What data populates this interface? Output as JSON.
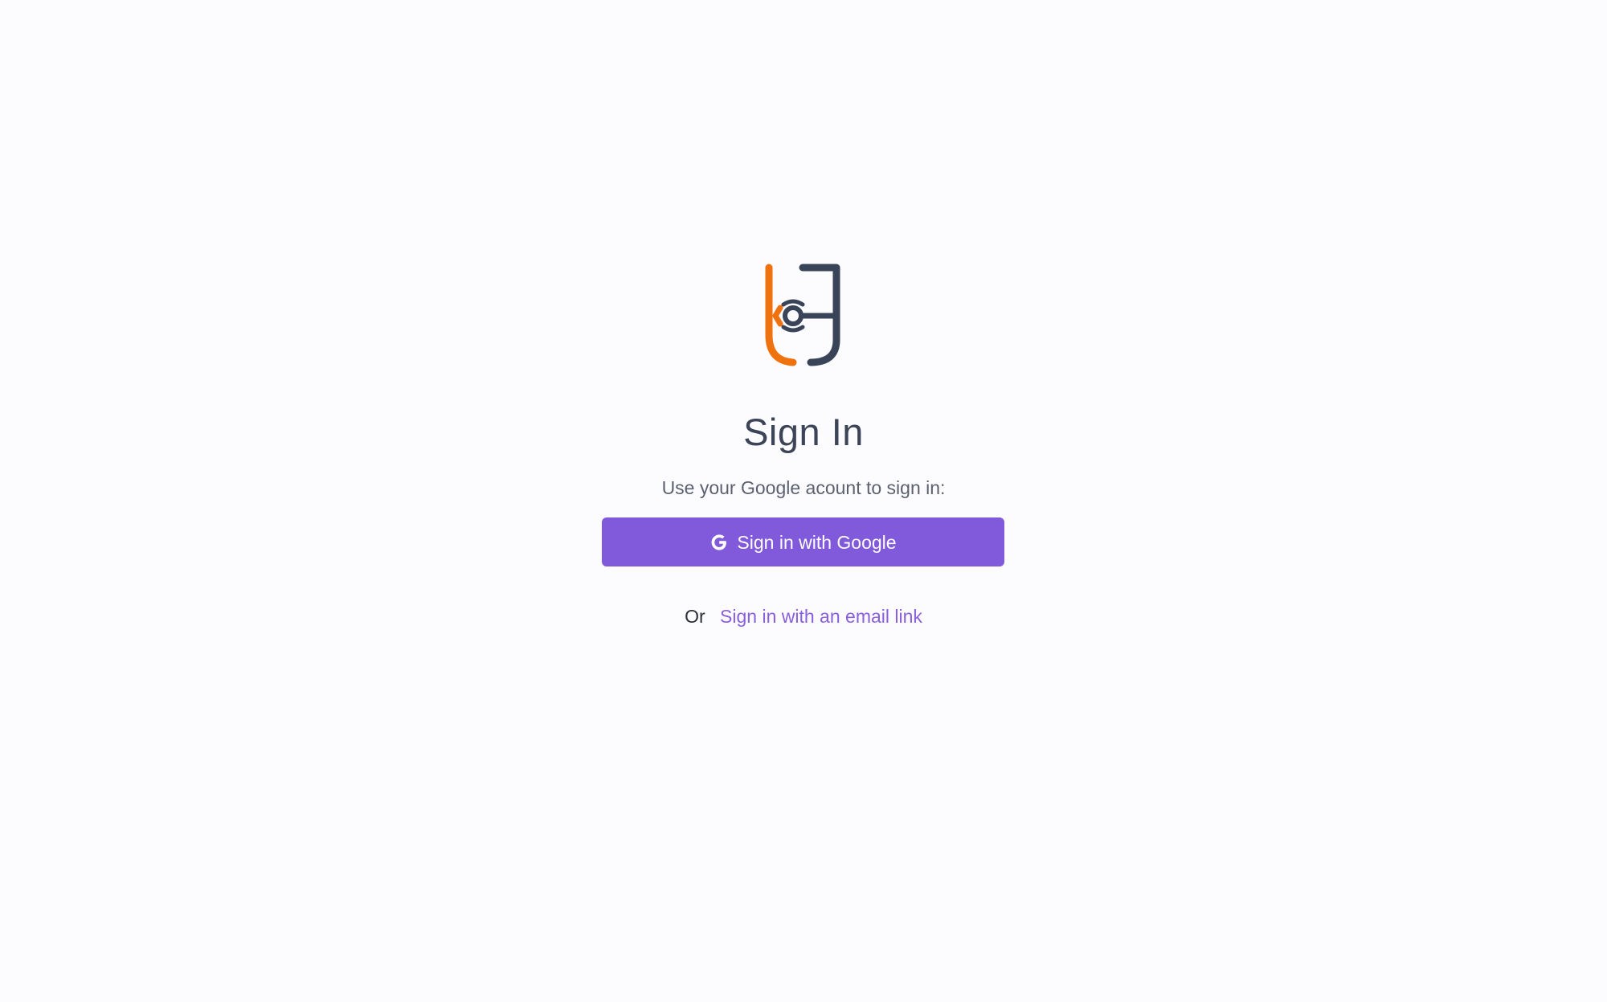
{
  "logo": {
    "icon": "brand-logo-icon",
    "colors": {
      "orange": "#f0720f",
      "navy": "#3a4459"
    }
  },
  "signin": {
    "title": "Sign In",
    "subtitle": "Use your Google acount to sign in:",
    "google_button": {
      "label": "Sign in with Google",
      "icon": "google-g-icon",
      "background": "#8159db"
    },
    "alternative": {
      "prefix": "Or",
      "link_label": "Sign in with an email link",
      "link_color": "#8a5fdc"
    }
  }
}
